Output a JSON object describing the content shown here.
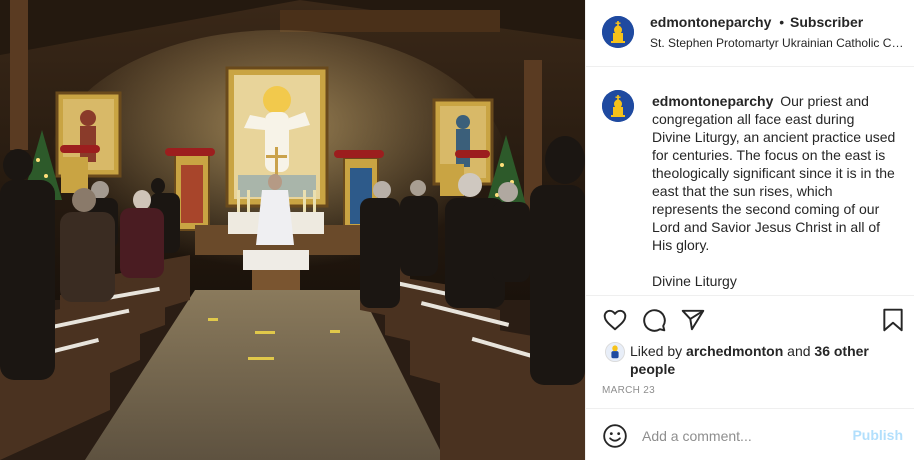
{
  "header": {
    "username": "edmontoneparchy",
    "separator": "•",
    "subscriber_label": "Subscriber",
    "location": "St. Stephen Protomartyr Ukrainian Catholic Church"
  },
  "caption": {
    "username": "edmontoneparchy",
    "text": "Our priest and congregation all face east during Divine Liturgy, an ancient practice used for centuries. The focus on the east is theologically significant since it is in the east that the sun rises, which represents the second coming of our Lord and Savior Jesus Christ in all of His glory.",
    "more": "Divine Liturgy"
  },
  "actions": {
    "icons": [
      "heart-icon",
      "comment-icon",
      "share-icon",
      "bookmark-icon"
    ],
    "liked_by_prefix": "Liked by",
    "liked_by_user": "archedmonton",
    "liked_by_and": "and",
    "others": "36 other people",
    "date": "March 23"
  },
  "comment_box": {
    "placeholder": "Add a comment...",
    "publish_label": "Publish",
    "emoji_icon": "smiley-icon"
  },
  "colors": {
    "avatar_blue": "#1f4aa0",
    "avatar_yellow": "#f6c21a",
    "publish_disabled": "#b2dffc",
    "muted": "#8e8e8e"
  }
}
